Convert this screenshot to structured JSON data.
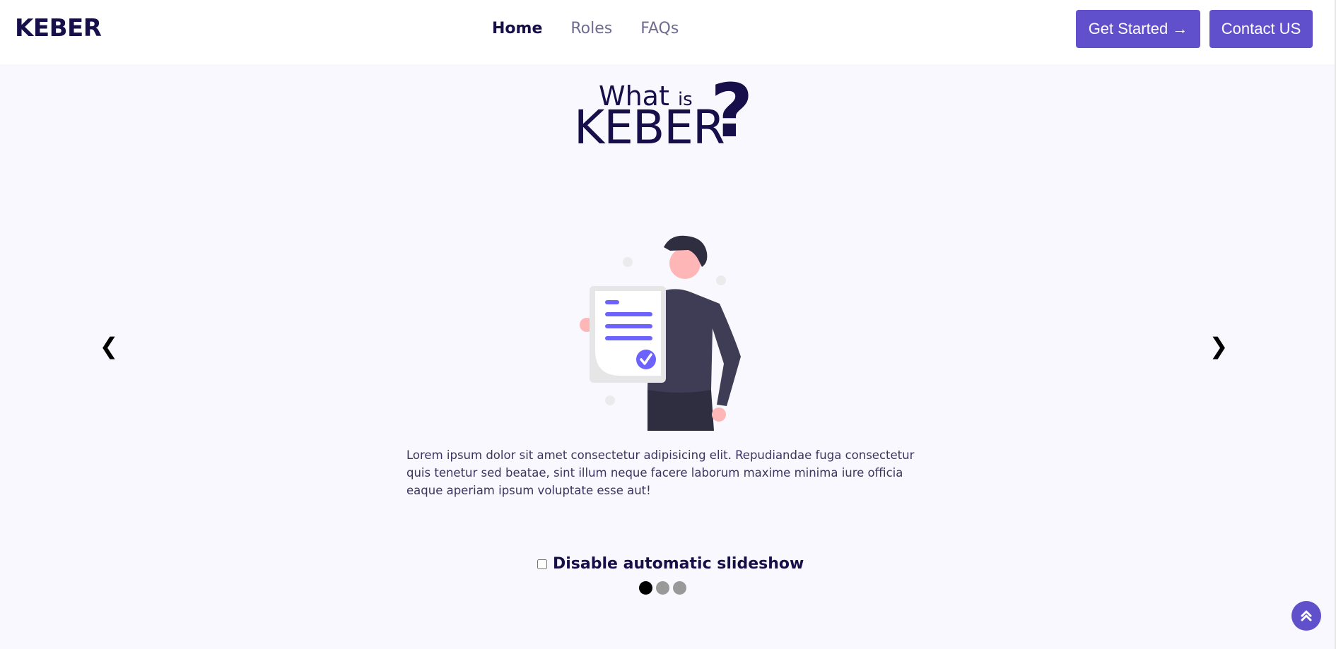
{
  "header": {
    "logo": "KEBER",
    "nav": [
      {
        "label": "Home",
        "active": true
      },
      {
        "label": "Roles",
        "active": false
      },
      {
        "label": "FAQs",
        "active": false
      }
    ],
    "get_started_label": "Get Started →",
    "contact_label": "Contact US"
  },
  "hero": {
    "what": "What",
    "is": "is",
    "brand": "KEBER",
    "qmark": "?"
  },
  "slideshow": {
    "prev_arrow": "❮",
    "next_arrow": "❯",
    "illustration": "person-holding-approved-document",
    "description": "Lorem ipsum dolor sit amet consectetur adipisicing elit. Repudiandae fuga consectetur quis tenetur sed beatae, sint illum neque facere laborum maxime minima iure officia eaque aperiam ipsum voluptate esse aut!",
    "disable_toggle_label": "Disable automatic slideshow",
    "disable_toggle_checked": false,
    "dots": [
      {
        "index": 1,
        "active": true
      },
      {
        "index": 2,
        "active": false
      },
      {
        "index": 3,
        "active": false
      }
    ]
  },
  "scroll_top_icon": "double-chevron-up-icon",
  "colors": {
    "brand_dark": "#170f49",
    "accent": "#6150cb",
    "illustration_purple": "#6c63ff",
    "background": "#f9f8fe"
  }
}
